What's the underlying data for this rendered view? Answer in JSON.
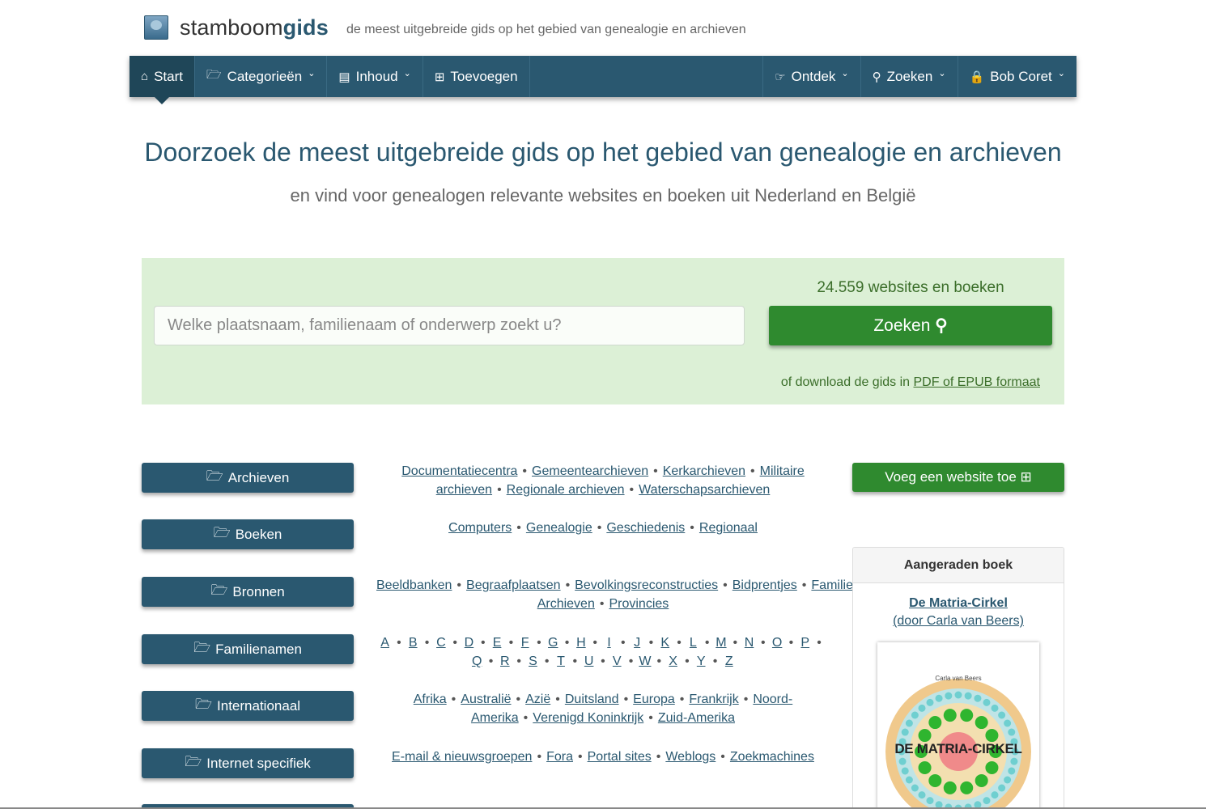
{
  "brand": {
    "name_plain": "stamboom",
    "name_bold": "gids",
    "tagline": "de meest uitgebreide gids op het gebied van genealogie en archieven"
  },
  "nav": {
    "left": [
      {
        "label": "Start",
        "icon": "home-icon",
        "glyph": "⌂"
      },
      {
        "label": "Categorieën",
        "icon": "folder-open-icon",
        "glyph": "🗁"
      },
      {
        "label": "Inhoud",
        "icon": "book-icon",
        "glyph": "▤"
      },
      {
        "label": "Toevoegen",
        "icon": "plus-square-icon",
        "glyph": "⊞"
      }
    ],
    "right": [
      {
        "label": "Ontdek",
        "icon": "hand-pointer-icon",
        "glyph": "☞"
      },
      {
        "label": "Zoeken",
        "icon": "search-icon",
        "glyph": "⚲"
      },
      {
        "label": "Bob Coret",
        "icon": "lock-icon",
        "glyph": "🔒"
      }
    ]
  },
  "hero": {
    "title": "Doorzoek de meest uitgebreide gids op het gebied van genealogie en archieven",
    "subtitle": "en vind voor genealogen relevante websites en boeken uit Nederland en België"
  },
  "search": {
    "placeholder": "Welke plaatsnaam, familienaam of onderwerp zoekt u?",
    "count": "24.559 websites en boeken",
    "button": "Zoeken",
    "download_prefix": "of download de gids in",
    "download_link": "PDF of EPUB formaat"
  },
  "categories": [
    {
      "label": "Archieven",
      "links": [
        "Documentatiecentra",
        "Gemeentearchieven",
        "Kerkarchieven",
        "Militaire archieven",
        "Regionale archieven",
        "Waterschapsarchieven"
      ]
    },
    {
      "label": "Boeken",
      "links": [
        "Computers",
        "Genealogie",
        "Geschiedenis",
        "Regionaal"
      ]
    },
    {
      "label": "Bronnen",
      "links": [
        "Beeldbanken",
        "Begraafplaatsen",
        "Bevolkingsreconstructies",
        "Bidprentjes",
        "Familieberichten",
        "Krantenbanken",
        "Open Archieven",
        "Provincies"
      ]
    },
    {
      "label": "Familienamen",
      "links": [
        "A",
        "B",
        "C",
        "D",
        "E",
        "F",
        "G",
        "H",
        "I",
        "J",
        "K",
        "L",
        "M",
        "N",
        "O",
        "P",
        "Q",
        "R",
        "S",
        "T",
        "U",
        "V",
        "W",
        "X",
        "Y",
        "Z"
      ]
    },
    {
      "label": "Internationaal",
      "links": [
        "Afrika",
        "Australië",
        "Azië",
        "Duitsland",
        "Europa",
        "Frankrijk",
        "Noord-Amerika",
        "Verenigd Koninkrijk",
        "Zuid-Amerika"
      ]
    },
    {
      "label": "Internet specifiek",
      "links": [
        "E-mail & nieuwsgroepen",
        "Fora",
        "Portal sites",
        "Weblogs",
        "Zoekmachines"
      ]
    }
  ],
  "sidebar": {
    "add_button": "Voeg een website toe ⊞",
    "book_header": "Aangeraden boek",
    "book_title": "De Matria-Cirkel",
    "book_author": "(door Carla van Beers)",
    "cover_author": "Carla van Beers",
    "cover_title": "DE MATRIA-CIRKEL"
  },
  "colors": {
    "primary": "#2a5870",
    "green": "#2f8a2f",
    "panel": "#dcf0d6"
  }
}
